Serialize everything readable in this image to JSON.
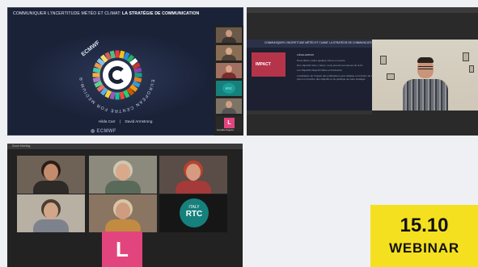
{
  "slide": {
    "title_plain": "COMMUNIQUER L'INCERTITUDE MÉTÉO ET CLIMAT:",
    "title_bold": "LA STRATÉGIE DE COMMUNICATION",
    "logo_word": "ECMWF",
    "ring_text": "EUROPEAN CENTRE FOR MEDIUM-RANGE WEATHER FORECASTS",
    "presenter_1": "Hilda Carr",
    "separator": "|",
    "presenter_2": "David Armstrong",
    "footer": "ECMWF"
  },
  "side_strip": {
    "tiles": [
      {
        "kind": "video",
        "color": "#6b5a4a",
        "label": ""
      },
      {
        "kind": "video",
        "color": "#8a6d55",
        "label": ""
      },
      {
        "kind": "video",
        "color": "#a07060",
        "label": ""
      },
      {
        "kind": "rtc",
        "color": "#16807c",
        "label": "RTC"
      },
      {
        "kind": "video",
        "color": "#7d7466",
        "label": ""
      },
      {
        "kind": "l",
        "color": "#e2457d",
        "label": "L"
      }
    ],
    "bottom_label": "Camilla Frigerio"
  },
  "presentation": {
    "window_title": "",
    "slide_header": "COMMUNIQUER L'INCERTITUDE MÉTÉO ET CLIMAT: LA STRATÉGIE DE COMMUNICATION",
    "impact_label": "IMPACT",
    "bullets": [
      "L'ÉVALUATION",
      "Nous allons mettre quelque chose en oeuvre",
      "Nos objectifs Vous y Serez, nous prenons les tenues de la fin",
      "Les Objectifs Objectif Cibles et Production",
      "L'évaluation de l'impact des publications sera réalisée en fonction de l'impact",
      "prévu en fonction des objectifs et du publique de notre stratégie"
    ]
  },
  "gallery": {
    "window_title": "Zoom Meeting",
    "tiles": [
      {
        "name": "",
        "bg": "#6e6257",
        "skin": "#c48b6c",
        "shirt": "#2e2a28",
        "hair": "#2b1d16"
      },
      {
        "name": "",
        "bg": "#8c8a7c",
        "skin": "#d8a98a",
        "shirt": "#5a6a5a",
        "hair": "#cfc7b2"
      },
      {
        "name": "",
        "bg": "#5a4c46",
        "skin": "#d59a80",
        "shirt": "#a43a3a",
        "hair": "#b6432c"
      },
      {
        "name": "",
        "bg": "#b7b0a3",
        "skin": "#d2a688",
        "shirt": "#7d828c",
        "hair": "#4b3d33"
      },
      {
        "name": "",
        "bg": "#8a7462",
        "skin": "#cf9c80",
        "shirt": "#c28b42",
        "hair": "#d8c7a2"
      },
      {
        "name": "",
        "bg": "#161616",
        "rtc_top": "ITALY",
        "rtc_main": "RTC"
      }
    ],
    "bottom_l": "L"
  },
  "badge": {
    "date": "15.10",
    "label": "WEBINAR"
  }
}
